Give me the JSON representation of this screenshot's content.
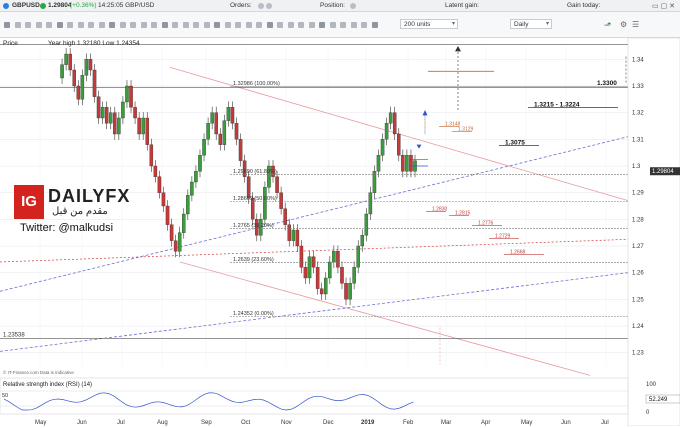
{
  "header": {
    "symbol": "GBPUSD",
    "price": "1.29804",
    "change": "(+0.36%)",
    "time": "14:25:05 GBP/USD"
  },
  "toolbar": {
    "orders_label": "Orders:",
    "position_label": "Position:",
    "latent_gain_label": "Latent gain:",
    "gain_today_label": "Gain today:",
    "units_value": "200 units",
    "timeframe_value": "Daily"
  },
  "chart_info": {
    "price_label": "Price",
    "year_high_low": "Year high 1.32180 Low 1.24354"
  },
  "price_axis": [
    "1.34",
    "1.33",
    "1.32",
    "1.31",
    "1.3",
    "1.29",
    "1.28",
    "1.27",
    "1.26",
    "1.25",
    "1.24",
    "1.23"
  ],
  "current_price_tag": "1.29804",
  "left_level_label": "1.23538",
  "months": [
    "May",
    "Jun",
    "Jul",
    "Aug",
    "Sep",
    "Oct",
    "Nov",
    "Dec",
    "2019",
    "Feb",
    "Mar",
    "Apr",
    "May",
    "Jun",
    "Jul"
  ],
  "fib_levels": [
    {
      "label": "1.32986 (100.00%)"
    },
    {
      "label": "1.29690 (61.80%)"
    },
    {
      "label": "1.28669 (50.00%)"
    },
    {
      "label": "1.2765 (38.20%)"
    },
    {
      "label": "1.2639 (23.60%)"
    },
    {
      "label": "1.24352 (0.00%)"
    }
  ],
  "annotations": {
    "a3300": "1.3300",
    "a3215": "1.3215 - 1.3224",
    "a3075": "1.3075",
    "a3148": "1.3148",
    "a3129": "1.3129",
    "a2830": "1.2830",
    "a2815": "1.2815",
    "a2776": "1.2776",
    "a2729": "1.2729",
    "a2668": "1.2668"
  },
  "brand": {
    "logo_text": "IG",
    "name": "DAILYFX",
    "arabic": "مقدم من قبل",
    "twitter": "Twitter: @malkudsi"
  },
  "rsi": {
    "label": "Relative strength index (RSI) (14)",
    "value": "52.249",
    "axis_top": "100",
    "axis_mid": "50",
    "axis_bottom": "0"
  },
  "copyright": "© IT-Finance.com Data is indicative"
}
